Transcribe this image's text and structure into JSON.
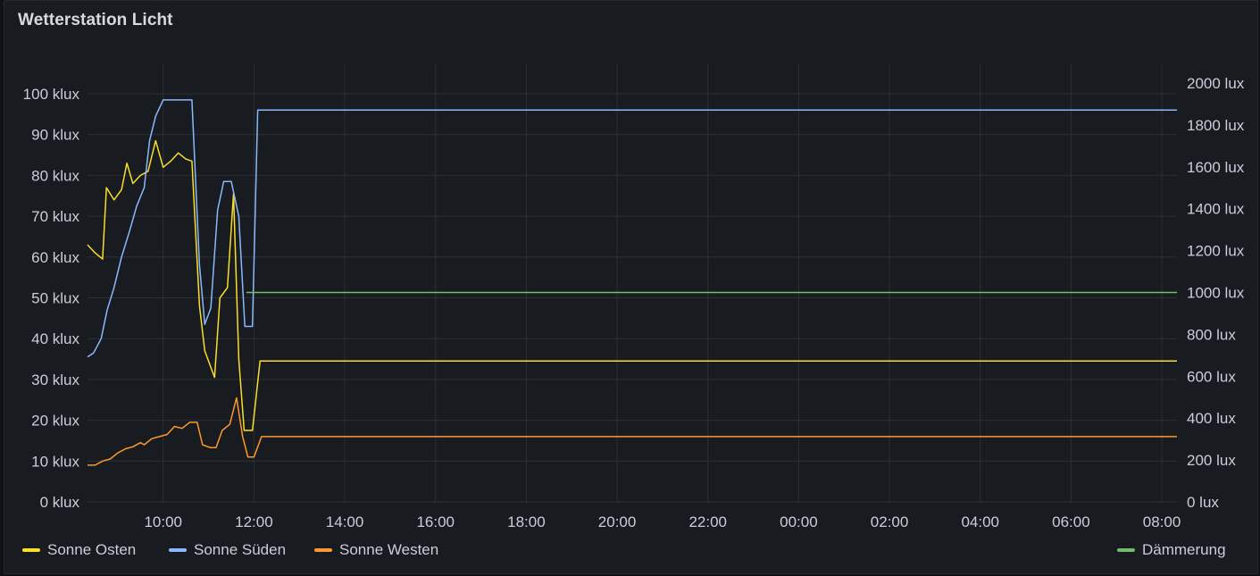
{
  "panel": {
    "title": "Wetterstation Licht"
  },
  "chart_data": {
    "type": "line",
    "x_range": [
      "08:20",
      "08:20 (+1 day)"
    ],
    "x_ticks": [
      "10:00",
      "12:00",
      "14:00",
      "16:00",
      "18:00",
      "20:00",
      "22:00",
      "00:00",
      "02:00",
      "04:00",
      "06:00",
      "08:00"
    ],
    "y_left": {
      "unit": "klux",
      "ylim": [
        0,
        100
      ],
      "ticks": [
        "0 klux",
        "10 klux",
        "20 klux",
        "30 klux",
        "40 klux",
        "50 klux",
        "60 klux",
        "70 klux",
        "80 klux",
        "90 klux",
        "100 klux"
      ]
    },
    "y_right": {
      "unit": "lux",
      "ylim": [
        0,
        2000
      ],
      "ticks": [
        "0 lux",
        "200 lux",
        "400 lux",
        "600 lux",
        "800 lux",
        "1000 lux",
        "1200 lux",
        "1400 lux",
        "1600 lux",
        "1800 lux",
        "2000 lux"
      ]
    },
    "grid": true,
    "legend_placement": "bottom",
    "series": [
      {
        "name": "Sonne Osten",
        "axis": "left",
        "color": "#fade2a",
        "points": [
          [
            "08:20",
            63
          ],
          [
            "08:30",
            61
          ],
          [
            "08:40",
            59.5
          ],
          [
            "08:45",
            77
          ],
          [
            "08:55",
            74
          ],
          [
            "09:05",
            76.5
          ],
          [
            "09:12",
            83
          ],
          [
            "09:20",
            78
          ],
          [
            "09:30",
            80
          ],
          [
            "09:40",
            81
          ],
          [
            "09:50",
            88.5
          ],
          [
            "10:00",
            82
          ],
          [
            "10:10",
            83.5
          ],
          [
            "10:20",
            85.5
          ],
          [
            "10:30",
            84
          ],
          [
            "10:38",
            83.5
          ],
          [
            "10:48",
            48
          ],
          [
            "10:55",
            37
          ],
          [
            "11:08",
            30.5
          ],
          [
            "11:15",
            50
          ],
          [
            "11:25",
            52.5
          ],
          [
            "11:33",
            75.5
          ],
          [
            "11:40",
            35
          ],
          [
            "11:47",
            17.5
          ],
          [
            "11:58",
            17.5
          ],
          [
            "12:08",
            34.5
          ],
          [
            "08:20+1",
            34.5
          ]
        ]
      },
      {
        "name": "Sonne Süden",
        "axis": "left",
        "color": "#8ab8ff",
        "points": [
          [
            "08:20",
            35.5
          ],
          [
            "08:28",
            36.5
          ],
          [
            "08:38",
            40
          ],
          [
            "08:46",
            47
          ],
          [
            "08:55",
            52.5
          ],
          [
            "09:05",
            60
          ],
          [
            "09:15",
            66
          ],
          [
            "09:25",
            72.5
          ],
          [
            "09:35",
            77
          ],
          [
            "09:42",
            88.5
          ],
          [
            "09:50",
            94.5
          ],
          [
            "10:00",
            98.5
          ],
          [
            "10:38",
            98.5
          ],
          [
            "10:48",
            58
          ],
          [
            "10:55",
            43.5
          ],
          [
            "11:03",
            47.5
          ],
          [
            "11:12",
            71.5
          ],
          [
            "11:20",
            78.5
          ],
          [
            "11:30",
            78.5
          ],
          [
            "11:40",
            70
          ],
          [
            "11:48",
            43
          ],
          [
            "11:58",
            43
          ],
          [
            "12:05",
            96
          ],
          [
            "08:20+1",
            96
          ]
        ]
      },
      {
        "name": "Sonne Westen",
        "axis": "left",
        "color": "#ff9830",
        "points": [
          [
            "08:20",
            9
          ],
          [
            "08:30",
            9
          ],
          [
            "08:40",
            10
          ],
          [
            "08:50",
            10.5
          ],
          [
            "09:00",
            12
          ],
          [
            "09:10",
            13
          ],
          [
            "09:20",
            13.5
          ],
          [
            "09:30",
            14.5
          ],
          [
            "09:35",
            14
          ],
          [
            "09:45",
            15.5
          ],
          [
            "09:55",
            16
          ],
          [
            "10:05",
            16.5
          ],
          [
            "10:15",
            18.5
          ],
          [
            "10:25",
            18
          ],
          [
            "10:35",
            19.5
          ],
          [
            "10:45",
            19.5
          ],
          [
            "10:52",
            14
          ],
          [
            "11:02",
            13.3
          ],
          [
            "11:10",
            13.3
          ],
          [
            "11:18",
            17.5
          ],
          [
            "11:28",
            19
          ],
          [
            "11:37",
            25.5
          ],
          [
            "11:45",
            16
          ],
          [
            "11:52",
            11
          ],
          [
            "12:00",
            11
          ],
          [
            "12:10",
            16
          ],
          [
            "08:20+1",
            16
          ]
        ]
      },
      {
        "name": "Dämmerung",
        "axis": "right",
        "color": "#73bf69",
        "points": [
          [
            "11:50",
            1000
          ],
          [
            "08:20+1",
            1000
          ]
        ]
      }
    ]
  },
  "legend": {
    "left": [
      {
        "label": "Sonne Osten",
        "color": "#fade2a"
      },
      {
        "label": "Sonne Süden",
        "color": "#8ab8ff"
      },
      {
        "label": "Sonne Westen",
        "color": "#ff9830"
      }
    ],
    "right": [
      {
        "label": "Dämmerung",
        "color": "#73bf69"
      }
    ]
  }
}
